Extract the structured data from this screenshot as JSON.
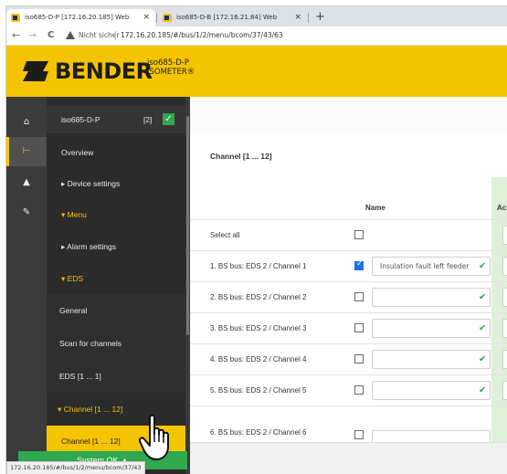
{
  "browser": {
    "tabs": [
      {
        "title": "iso685-D-P [172.16.20.185] Web",
        "active": true
      },
      {
        "title": "iso685-D-B [172.16.21.84] Web",
        "active": false
      }
    ],
    "close_glyph": "×",
    "new_tab_glyph": "+",
    "back_glyph": "←",
    "forward_glyph": "→",
    "reload_glyph": "C",
    "security_text": "Nicht sicher",
    "url": "172.16.20.185/#/bus/1/2/menu/bcom/37/43/63",
    "status_url": "172.16.20.185/#/bus/1/2/menu/bcom/37/43"
  },
  "header": {
    "brand": "BENDER",
    "product_name": "iso685-D-P",
    "product_sub": "ISOMETER®",
    "brand_color": "#f5c400"
  },
  "rail": {
    "icons": [
      "home-icon",
      "tree-icon",
      "warning-icon",
      "wrench-icon"
    ],
    "glyphs": [
      "⌂",
      "⊢",
      "▲",
      "✎"
    ]
  },
  "sidebar": {
    "device": {
      "name": "iso685-D-P",
      "count": "[2]",
      "ok": "✓"
    },
    "items": [
      {
        "label": "Overview"
      },
      {
        "label": "▸ Device settings"
      },
      {
        "label": "▾ Menu"
      },
      {
        "label": "▸ Alarm settings"
      },
      {
        "label": "▾ EDS"
      },
      {
        "label": "General"
      },
      {
        "label": "Scan for channels"
      },
      {
        "label": "EDS [1 ... 1]"
      },
      {
        "label": "▾ Channel [1 ... 12]"
      },
      {
        "label": "Channel [1 ... 12]"
      }
    ]
  },
  "main": {
    "section_title": "Channel [1 ... 12]",
    "col_name": "Name",
    "col_active": "Ac",
    "select_all": "Select all",
    "check_glyph": "✔",
    "rows": [
      {
        "label": "1. BS bus: EDS 2 / Channel 1",
        "checked": true,
        "value": "Insulation fault left feeder"
      },
      {
        "label": "2. BS bus: EDS 2 / Channel 2",
        "checked": false,
        "value": ""
      },
      {
        "label": "3. BS bus: EDS 2 / Channel 3",
        "checked": false,
        "value": ""
      },
      {
        "label": "4. BS bus: EDS 2 / Channel 4",
        "checked": false,
        "value": ""
      },
      {
        "label": "5. BS bus: EDS 2 / Channel 5",
        "checked": false,
        "value": ""
      },
      {
        "label": "6. BS bus: EDS 2 / Channel 6",
        "checked": false,
        "value": ""
      }
    ]
  },
  "status": {
    "label": "System OK ▲",
    "color": "#2fa84f"
  }
}
